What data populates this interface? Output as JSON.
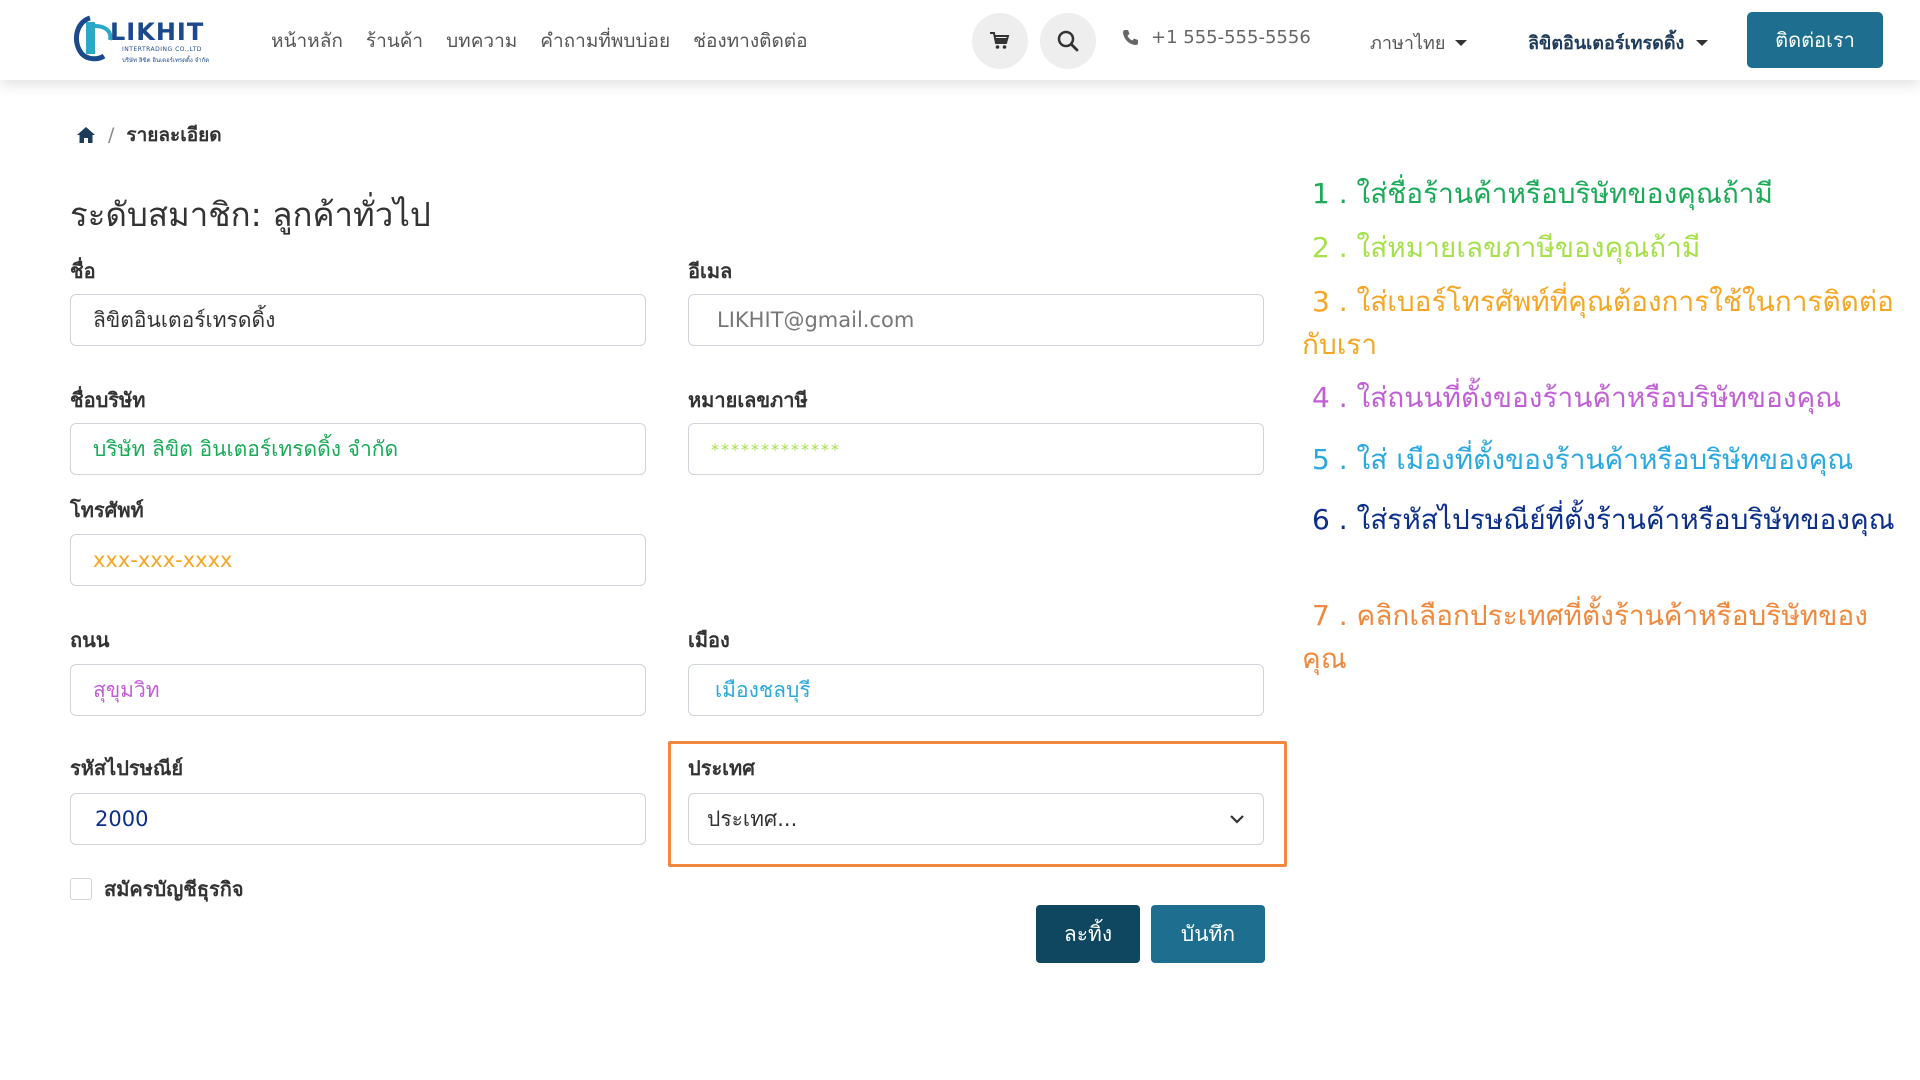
{
  "colors": {
    "primary": "#1e6f8f",
    "primary_dark": "#0f4660",
    "highlight_border": "#f0883e",
    "company_green": "#1aaa58",
    "tax_lime": "#a6e04c",
    "phone_orange": "#f5a623",
    "street_purple": "#c05fd6",
    "city_blue": "#2aa8e0",
    "postcode_navy": "#0b2f8a",
    "country_orange": "#f0883e"
  },
  "header": {
    "logo": {
      "brand": "LIKHIT",
      "sub": "INTERTRADING CO.,LTD",
      "sub2": "บริษัท ลิขิต อินเตอร์เทรดดิ้ง จำกัด",
      "icon": "likhit-logo-icon"
    },
    "nav": [
      "หน้าหลัก",
      "ร้านค้า",
      "บทความ",
      "คำถามที่พบบ่อย",
      "ช่องทางติดต่อ"
    ],
    "cart_icon": "cart-icon",
    "search_icon": "search-icon",
    "phone_icon": "phone-icon",
    "phone": "+1 555-555-5556",
    "language": "ภาษาไทย",
    "user": "ลิขิตอินเตอร์เทรดดิ้ง",
    "contact_button": "ติดต่อเรา"
  },
  "breadcrumb": {
    "home_icon": "home-icon",
    "separator": "/",
    "current": "รายละเอียด"
  },
  "form": {
    "title": "ระดับสมาชิก: ลูกค้าทั่วไป",
    "name": {
      "label": "ชื่อ",
      "value": "ลิขิตอินเตอร์เทรดดิ้ง"
    },
    "email": {
      "label": "อีเมล",
      "value": "LIKHIT@gmail.com"
    },
    "company": {
      "label": "ชื่อบริษัท",
      "value": "บริษัท ลิขิต อินเตอร์เทรดดิ้ง จำกัด"
    },
    "tax_id": {
      "label": "หมายเลขภาษี",
      "value": "*************"
    },
    "phone": {
      "label": "โทรศัพท์",
      "value": "xxx-xxx-xxxx"
    },
    "street": {
      "label": "ถนน",
      "value": "สุขุมวิท"
    },
    "city": {
      "label": "เมือง",
      "value": "เมืองชลบุรี"
    },
    "postcode": {
      "label": "รหัสไปรษณีย์",
      "value": "2000"
    },
    "country": {
      "label": "ประเทศ",
      "value": "ประเทศ...",
      "icon": "chevron-down-icon"
    },
    "business_account": "สมัครบัญชีธุรกิจ",
    "discard": "ละทิ้ง",
    "save": "บันทึก"
  },
  "instructions": [
    {
      "num": "1 .",
      "text": "ใส่ชื่อร้านค้าหรือบริษัทของคุณถ้ามี"
    },
    {
      "num": "2 .",
      "text": "ใส่หมายเลขภาษีของคุณถ้ามี"
    },
    {
      "num": "3 .",
      "text": "ใส่เบอร์โทรศัพท์ที่คุณต้องการใช้ในการติดต่อกับเรา"
    },
    {
      "num": "4 .",
      "text": "ใส่ถนนที่ตั้งของร้านค้าหรือบริษัทของคุณ"
    },
    {
      "num": "5 .",
      "text": "ใส่ เมืองที่ตั้งของร้านค้าหรือบริษัทของคุณ"
    },
    {
      "num": "6 .",
      "text": "ใส่รหัสไปรษณีย์ที่ตั้งร้านค้าหรือบริษัทของคุณ"
    },
    {
      "num": "7 .",
      "text": "คลิกเลือกประเทศที่ตั้งร้านค้าหรือบริษัทของคุณ"
    }
  ]
}
